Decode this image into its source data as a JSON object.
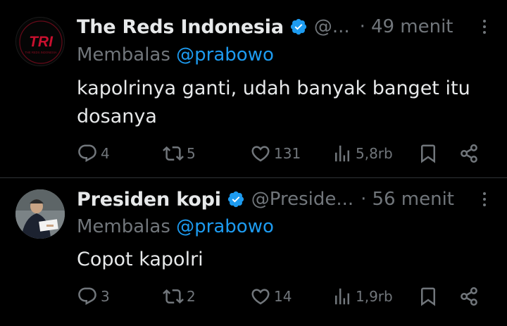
{
  "tweets": [
    {
      "name": "The Reds Indonesia",
      "handle": "@...",
      "separator": "·",
      "time": "49 menit",
      "reply_prefix": "Membalas",
      "reply_mention": "@prabowo",
      "text": "kapolrinya ganti, udah banyak banget itu dosanya",
      "avatar_logo_text": "TRI",
      "avatar_logo_subtext": "THE REDS INDONESIA",
      "counts": {
        "replies": "4",
        "reposts": "5",
        "likes": "131",
        "views": "5,8rb"
      }
    },
    {
      "name": "Presiden kopi",
      "handle": "@Preside...",
      "separator": "·",
      "time": "56 menit",
      "reply_prefix": "Membalas",
      "reply_mention": "@prabowo",
      "text": "Copot kapolri",
      "counts": {
        "replies": "3",
        "reposts": "2",
        "likes": "14",
        "views": "1,9rb"
      }
    }
  ],
  "colors": {
    "background": "#000000",
    "text_primary": "#e7e9ea",
    "text_secondary": "#71767b",
    "link": "#1d9bf0",
    "verified_badge": "#1d9bf0",
    "divider": "#2f3336",
    "logo_red": "#c8102e"
  },
  "icons": [
    "verified-badge-icon",
    "more-options-icon",
    "reply-icon",
    "repost-icon",
    "like-icon",
    "views-icon",
    "bookmark-icon",
    "share-icon"
  ]
}
